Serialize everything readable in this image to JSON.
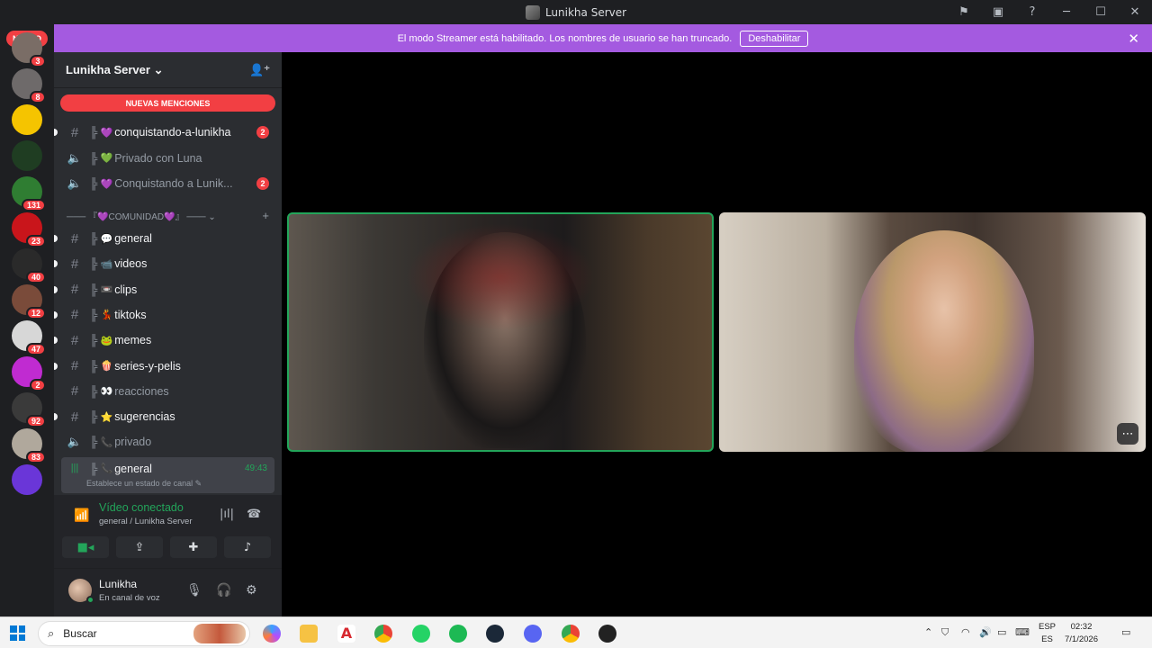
{
  "window": {
    "title": "Lunikha Server"
  },
  "rail": {
    "nuevo_label": "NUEVO",
    "servers": [
      {
        "badge": "3",
        "color": "#7a6d66"
      },
      {
        "badge": "8",
        "color": "#6e6a6a"
      },
      {
        "badge": "",
        "color": "#f5c400"
      },
      {
        "badge": "",
        "color": "#1f3d22"
      },
      {
        "badge": "131",
        "color": "#2f7d32"
      },
      {
        "badge": "23",
        "color": "#c9151b"
      },
      {
        "badge": "40",
        "color": "#2a2a2a"
      },
      {
        "badge": "12",
        "color": "#7a4b3a"
      },
      {
        "badge": "47",
        "color": "#d7d7d7"
      },
      {
        "badge": "2",
        "color": "#c02bd1"
      },
      {
        "badge": "92",
        "color": "#3a3a3a"
      },
      {
        "badge": "83",
        "color": "#b0a89c"
      },
      {
        "badge": "",
        "color": "#6a36d8"
      }
    ]
  },
  "notice": {
    "text": "El modo Streamer está habilitado. Los nombres de usuario se han truncado.",
    "button": "Deshabilitar"
  },
  "sidebar": {
    "server_name": "Lunikha Server",
    "new_mentions": "NUEVAS MENCIONES",
    "channels_top": [
      {
        "type": "text",
        "deco": "╠",
        "emoji": "💜",
        "name": "conquistando-a-lunikha",
        "badge": "2",
        "unread": true,
        "muted": false
      },
      {
        "type": "voice",
        "deco": "╠",
        "emoji": "💚",
        "name": "Privado con Luna",
        "badge": "",
        "unread": false,
        "muted": true
      },
      {
        "type": "voice",
        "deco": "╠",
        "emoji": "💜",
        "name": "Conquistando a Lunik...",
        "badge": "2",
        "unread": false,
        "muted": true
      }
    ],
    "category": "─── 『💜COMUNIDAD💜』 ───",
    "channels": [
      {
        "type": "text",
        "deco": "╠",
        "emoji": "💬",
        "name": "general",
        "unread": true,
        "muted": false
      },
      {
        "type": "text",
        "deco": "╠",
        "emoji": "📹",
        "name": "videos",
        "unread": true,
        "muted": false
      },
      {
        "type": "text",
        "deco": "╠",
        "emoji": "📼",
        "name": "clips",
        "unread": true,
        "muted": false
      },
      {
        "type": "text",
        "deco": "╠",
        "emoji": "💃",
        "name": "tiktoks",
        "unread": true,
        "muted": false
      },
      {
        "type": "text",
        "deco": "╠",
        "emoji": "🐸",
        "name": "memes",
        "unread": true,
        "muted": false
      },
      {
        "type": "text",
        "deco": "╠",
        "emoji": "🍿",
        "name": "series-y-pelis",
        "unread": true,
        "muted": false
      },
      {
        "type": "text",
        "deco": "╠",
        "emoji": "👀",
        "name": "reacciones",
        "unread": false,
        "muted": true
      },
      {
        "type": "text",
        "deco": "╠",
        "emoji": "⭐",
        "name": "sugerencias",
        "unread": true,
        "muted": false
      },
      {
        "type": "voice",
        "deco": "╠",
        "emoji": "📞",
        "name": "privado",
        "unread": false,
        "muted": true
      }
    ],
    "active_channel": {
      "deco": "╠",
      "emoji": "📞",
      "name": "general",
      "timer": "49:43",
      "status": "Establece un estado de canal ✎"
    }
  },
  "voice": {
    "title": "Vídeo conectado",
    "subtitle": "general / Lunikha Server"
  },
  "user": {
    "name": "Lunikha",
    "status": "En canal de voz"
  },
  "taskbar": {
    "search_placeholder": "Buscar",
    "lang_top": "ESP",
    "lang_bottom": "ES",
    "time": "02:32",
    "date": "7/1/2026"
  },
  "colors": {
    "accent": "#a45ae0",
    "danger": "#f23f43",
    "online": "#23a55a"
  }
}
